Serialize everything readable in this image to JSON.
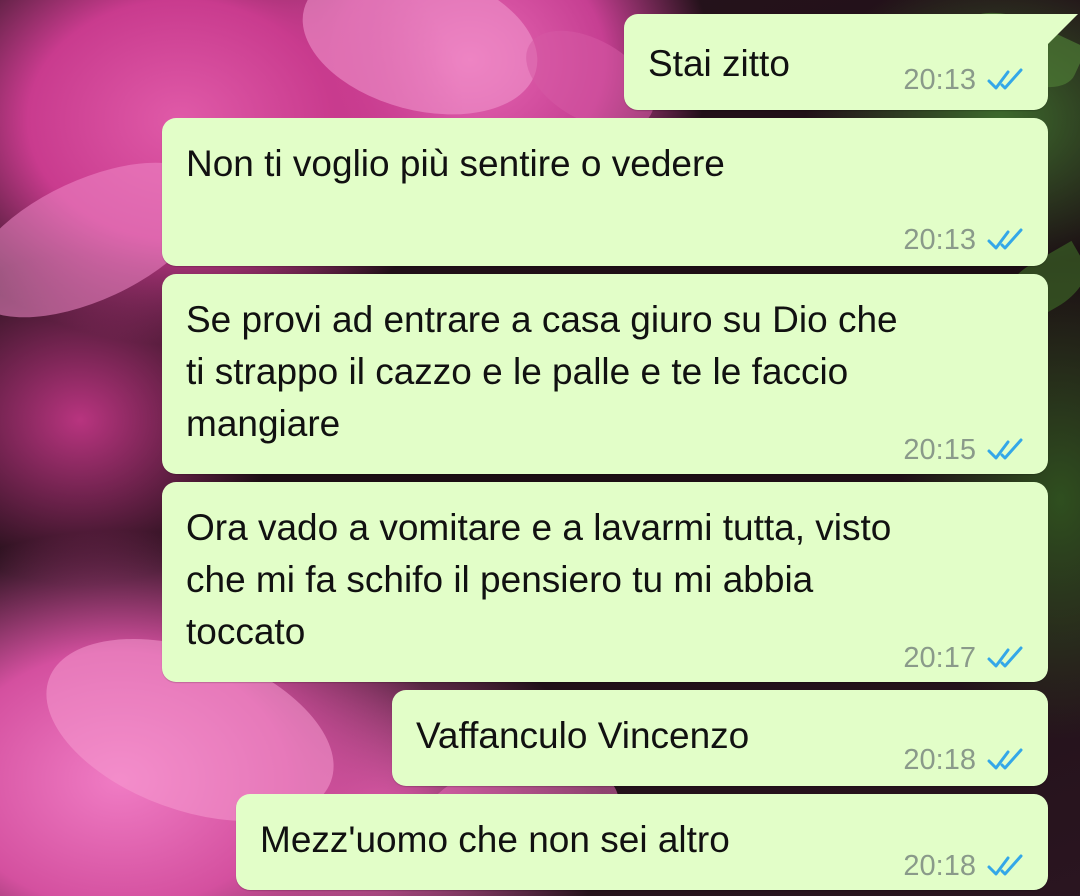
{
  "chat": {
    "messages": [
      {
        "text": "Stai zitto",
        "time": "20:13",
        "status": "read"
      },
      {
        "text": "Non ti voglio più sentire o vedere",
        "time": "20:13",
        "status": "read"
      },
      {
        "text": "Se provi ad entrare a casa giuro su Dio che\nti strappo il cazzo e le palle e te le faccio\nmangiare",
        "time": "20:15",
        "status": "read"
      },
      {
        "text": "Ora vado a vomitare e a lavarmi tutta, visto\nche mi fa schifo il pensiero tu mi abbia\ntoccato",
        "time": "20:17",
        "status": "read"
      },
      {
        "text": "Vaffanculo Vincenzo",
        "time": "20:18",
        "status": "read"
      },
      {
        "text": "Mezz'uomo che non sei altro",
        "time": "20:18",
        "status": "read"
      }
    ]
  },
  "colors": {
    "bubble_outgoing": "#e2fec8",
    "read_tick": "#34a7e8",
    "time_text": "#8a9a8a"
  },
  "icons": {
    "status_read": "double-check-icon"
  }
}
